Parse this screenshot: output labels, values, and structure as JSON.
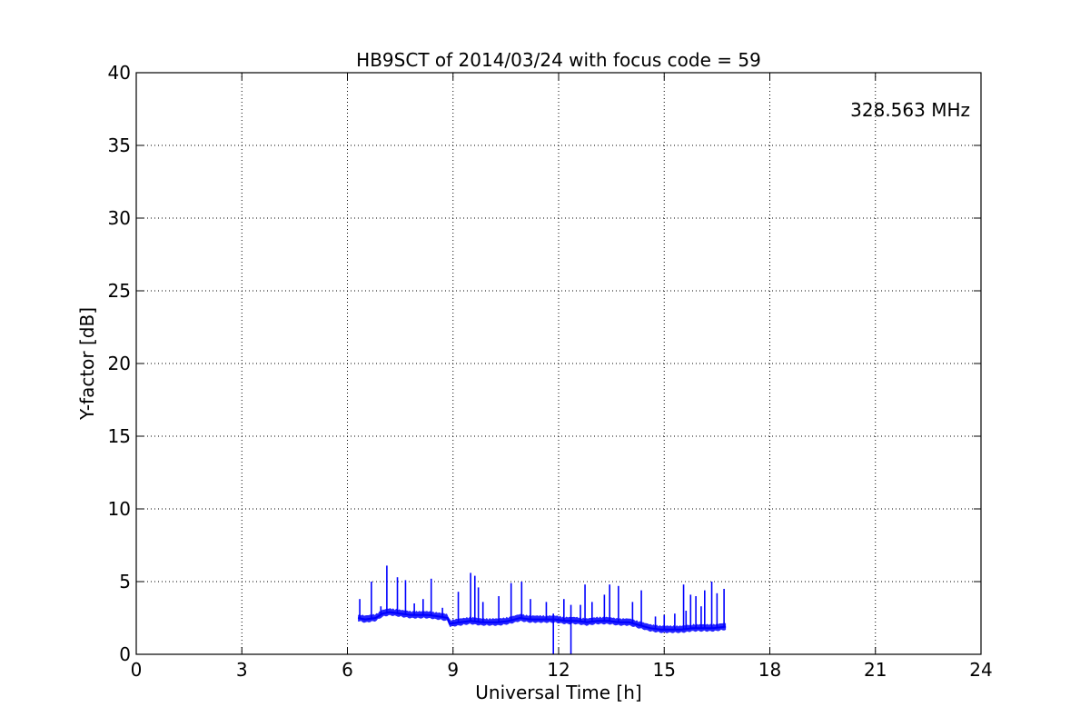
{
  "chart_data": {
    "type": "line",
    "title": "HB9SCT of 2014/03/24 with focus code = 59",
    "xlabel": "Universal Time [h]",
    "ylabel": "Y-factor [dB]",
    "xlim": [
      0,
      24
    ],
    "ylim": [
      0,
      40
    ],
    "xticks": [
      0,
      3,
      6,
      9,
      12,
      15,
      18,
      21,
      24
    ],
    "yticks": [
      0,
      5,
      10,
      15,
      20,
      25,
      30,
      35,
      40
    ],
    "xtick_labels": [
      "0",
      "3",
      "6",
      "9",
      "12",
      "15",
      "18",
      "21",
      "24"
    ],
    "ytick_labels": [
      "0",
      "5",
      "10",
      "15",
      "20",
      "25",
      "30",
      "35",
      "40"
    ],
    "grid": true,
    "annotation": {
      "text": "328.563 MHz",
      "color": "#0000ff",
      "position": "top-right"
    },
    "series": [
      {
        "color": "#0000ff",
        "baseline": {
          "x": [
            6.3,
            6.5,
            6.8,
            7.0,
            7.2,
            7.5,
            7.8,
            8.0,
            8.3,
            8.6,
            8.85,
            8.9,
            9.2,
            9.5,
            9.8,
            10.0,
            10.3,
            10.6,
            10.9,
            11.2,
            11.5,
            11.9,
            12.2,
            12.5,
            12.8,
            13.1,
            13.4,
            13.7,
            14.0,
            14.3,
            14.6,
            14.9,
            15.2,
            15.5,
            15.8,
            16.1,
            16.4,
            16.75
          ],
          "y": [
            2.5,
            2.4,
            2.5,
            2.8,
            2.9,
            2.8,
            2.7,
            2.7,
            2.7,
            2.6,
            2.5,
            2.1,
            2.2,
            2.3,
            2.2,
            2.2,
            2.2,
            2.3,
            2.5,
            2.4,
            2.4,
            2.4,
            2.3,
            2.3,
            2.2,
            2.3,
            2.3,
            2.2,
            2.2,
            2.0,
            1.8,
            1.7,
            1.7,
            1.7,
            1.8,
            1.8,
            1.8,
            1.9
          ]
        },
        "spikes": {
          "x": [
            6.35,
            6.68,
            6.95,
            7.12,
            7.42,
            7.65,
            7.9,
            8.15,
            8.38,
            8.7,
            9.15,
            9.5,
            9.62,
            9.72,
            9.85,
            10.3,
            10.65,
            10.95,
            11.2,
            11.65,
            11.85,
            12.15,
            12.35,
            12.62,
            12.75,
            12.95,
            13.3,
            13.45,
            13.7,
            14.1,
            14.35,
            14.75,
            15.0,
            15.3,
            15.55,
            15.62,
            15.75,
            15.9,
            16.05,
            16.15,
            16.35,
            16.5,
            16.7
          ],
          "y": [
            3.8,
            5.0,
            3.3,
            6.1,
            5.3,
            5.1,
            3.5,
            3.8,
            5.2,
            3.2,
            4.3,
            5.6,
            5.4,
            4.6,
            3.6,
            4.0,
            4.9,
            5.0,
            3.8,
            3.6,
            2.8,
            3.8,
            3.4,
            3.4,
            4.8,
            3.6,
            4.1,
            4.8,
            4.7,
            3.6,
            4.4,
            2.6,
            2.7,
            2.8,
            4.8,
            3.0,
            4.1,
            4.0,
            3.3,
            4.4,
            5.0,
            4.2,
            4.5
          ]
        },
        "dips": {
          "x": [
            11.85,
            12.35
          ],
          "y": [
            0,
            0
          ]
        }
      }
    ]
  }
}
